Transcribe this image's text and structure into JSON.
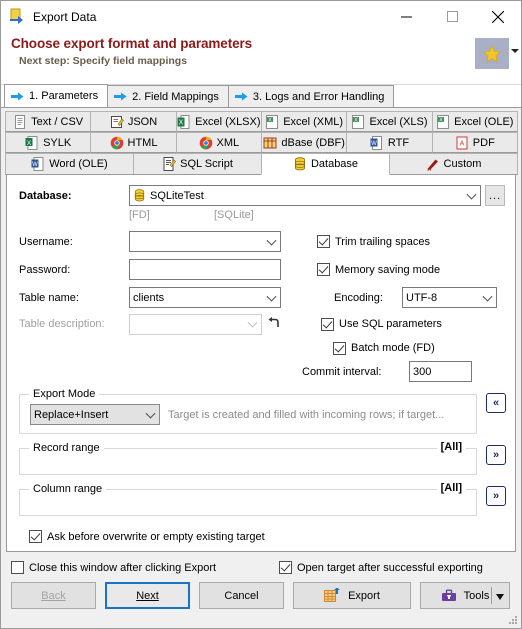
{
  "window": {
    "title": "Export Data",
    "icon": "export-data-icon",
    "minimize": "—",
    "maximize": "□",
    "close": "✕"
  },
  "header": {
    "title": "Choose export format and parameters",
    "subtitle": "Next step: Specify field mappings",
    "favorite_icon": "star-icon"
  },
  "step_tabs": [
    {
      "label": "1. Parameters",
      "active": true
    },
    {
      "label": "2. Field Mappings",
      "active": false
    },
    {
      "label": "3. Logs and Error Handling",
      "active": false
    }
  ],
  "format_tabs": {
    "row1": [
      {
        "label": "Text / CSV",
        "icon": "text-file-icon"
      },
      {
        "label": "JSON",
        "icon": "json-file-icon"
      },
      {
        "label": "Excel (XLSX)",
        "icon": "excel-xlsx-icon"
      },
      {
        "label": "Excel (XML)",
        "icon": "excel-xml-icon"
      },
      {
        "label": "Excel (XLS)",
        "icon": "excel-xls-icon"
      },
      {
        "label": "Excel (OLE)",
        "icon": "excel-ole-icon"
      }
    ],
    "row2": [
      {
        "label": "SYLK",
        "icon": "sylk-icon"
      },
      {
        "label": "HTML",
        "icon": "html-chrome-icon"
      },
      {
        "label": "XML",
        "icon": "xml-chrome-icon"
      },
      {
        "label": "dBase (DBF)",
        "icon": "dbase-icon"
      },
      {
        "label": "RTF",
        "icon": "rtf-word-icon"
      },
      {
        "label": "PDF",
        "icon": "pdf-icon"
      }
    ],
    "row3": [
      {
        "label": "Word (OLE)",
        "icon": "word-ole-icon",
        "selected": false
      },
      {
        "label": "SQL Script",
        "icon": "sql-script-icon",
        "selected": false
      },
      {
        "label": "Database",
        "icon": "database-icon",
        "selected": true
      },
      {
        "label": "Custom",
        "icon": "custom-pencil-icon",
        "selected": false
      }
    ]
  },
  "form": {
    "database_label": "Database:",
    "database_value": "SQLiteTest",
    "database_icon": "database-cylinder-icon",
    "browse_button": "...",
    "driver_tag": "[FD]",
    "engine_tag": "[SQLite]",
    "username_label": "Username:",
    "username_value": "",
    "password_label": "Password:",
    "password_value": "",
    "table_name_label": "Table name:",
    "table_name_value": "clients",
    "table_description_label": "Table description:",
    "table_description_value": "",
    "revert_icon": "revert-arrow-icon",
    "trim_trailing_spaces": {
      "label": "Trim trailing spaces",
      "checked": true
    },
    "memory_saving_mode": {
      "label": "Memory saving mode",
      "checked": true
    },
    "encoding_label": "Encoding:",
    "encoding_value": "UTF-8",
    "use_sql_parameters": {
      "label": "Use SQL parameters",
      "checked": true
    },
    "batch_mode": {
      "label": "Batch mode (FD)",
      "checked": true
    },
    "commit_interval_label": "Commit interval:",
    "commit_interval_value": "300"
  },
  "export_mode": {
    "group_title": "Export Mode",
    "value": "Replace+Insert",
    "description": "Target is created and filled with incoming rows; if target...",
    "collapse_button": "«"
  },
  "record_range": {
    "group_title": "Record range",
    "value": "[All]",
    "expand_button": "»"
  },
  "column_range": {
    "group_title": "Column range",
    "value": "[All]",
    "expand_button": "»"
  },
  "ask_before_overwrite": {
    "label": "Ask before overwrite or empty existing target",
    "checked": true
  },
  "bottom": {
    "close_window": {
      "label": "Close this window after clicking Export",
      "checked": false
    },
    "open_target": {
      "label": "Open target after successful exporting",
      "checked": true
    },
    "back": "Back",
    "next": "Next",
    "cancel": "Cancel",
    "export": "Export",
    "export_icon": "export-table-icon",
    "tools": "Tools",
    "tools_icon": "toolbox-icon"
  }
}
